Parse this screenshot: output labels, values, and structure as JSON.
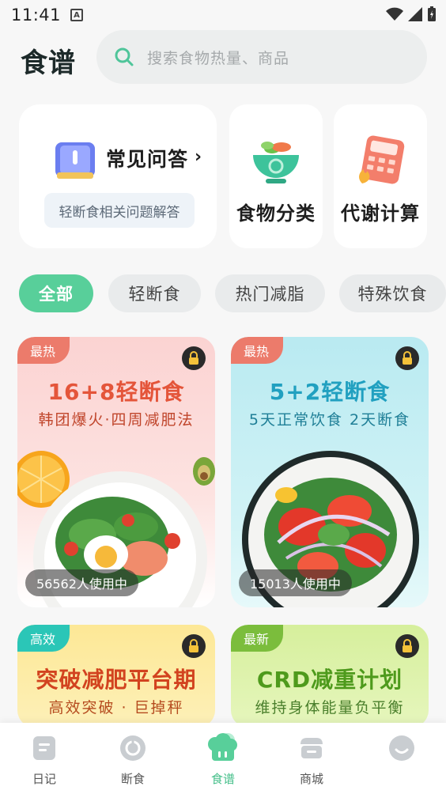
{
  "status_bar": {
    "time": "11:41",
    "notification_letter": "A"
  },
  "header": {
    "title": "食谱",
    "search_placeholder": "搜索食物热量、商品"
  },
  "faq_card": {
    "title": "常见问答",
    "arrow": "›",
    "subtitle": "轻断食相关问题解答"
  },
  "shortcut_cards": [
    {
      "label": "食物分类",
      "icon": "salad-bowl-icon"
    },
    {
      "label": "代谢计算",
      "icon": "calculator-icon"
    }
  ],
  "chips": [
    {
      "label": "全部",
      "active": true
    },
    {
      "label": "轻断食",
      "active": false
    },
    {
      "label": "热门减脂",
      "active": false
    },
    {
      "label": "特殊饮食",
      "active": false
    }
  ],
  "recipes": [
    {
      "badge": "最热",
      "title": "16+8轻断食",
      "subtitle": "韩团爆火·四周减肥法",
      "users": "56562人使用中",
      "locked": true
    },
    {
      "badge": "最热",
      "title": "5+2轻断食",
      "subtitle": "5天正常饮食 2天断食",
      "users": "15013人使用中",
      "locked": true
    },
    {
      "badge": "高效",
      "title": "突破减肥平台期",
      "subtitle": "高效突破 · 巨掉秤",
      "locked": true
    },
    {
      "badge": "最新",
      "title": "CRD减重计划",
      "subtitle": "维持身体能量负平衡",
      "locked": true
    }
  ],
  "bottom_nav": [
    {
      "label": "日记",
      "icon": "diary-icon",
      "active": false
    },
    {
      "label": "断食",
      "icon": "fasting-icon",
      "active": false
    },
    {
      "label": "食谱",
      "icon": "chef-hat-icon",
      "active": true
    },
    {
      "label": "商城",
      "icon": "shop-icon",
      "active": false
    },
    {
      "label": "",
      "icon": "profile-icon",
      "active": false
    }
  ],
  "colors": {
    "accent_green": "#58cf9a",
    "hot_badge": "#ec7b6b"
  }
}
